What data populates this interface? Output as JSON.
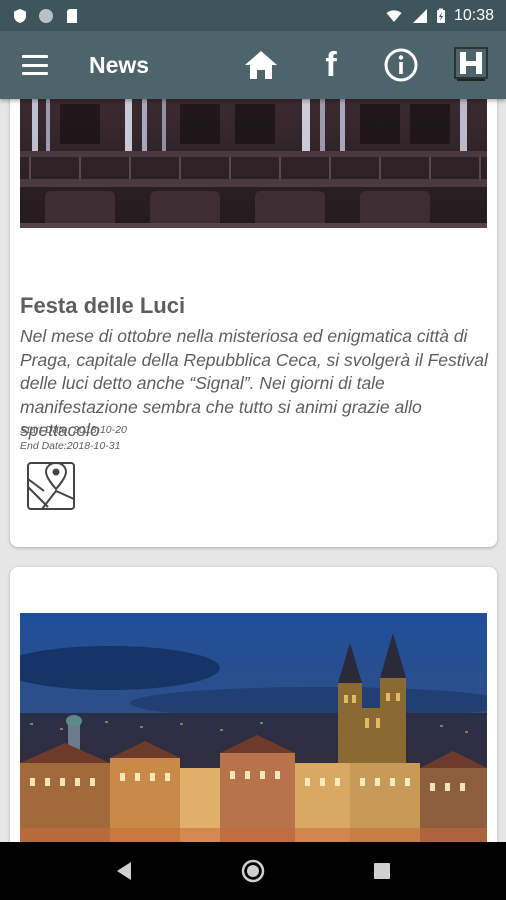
{
  "status_bar": {
    "time": "10:38",
    "icons": [
      "shield-icon",
      "circle-icon",
      "sd-card-icon",
      "wifi-icon",
      "signal-icon",
      "battery-icon"
    ]
  },
  "app_bar": {
    "title": "News",
    "actions": [
      "home-icon",
      "facebook-icon",
      "info-icon",
      "logo-icon"
    ],
    "facebook_glyph": "f"
  },
  "cards": [
    {
      "title": "Festa delle Luci",
      "description": "Nel mese di ottobre nella misteriosa ed enigmatica città di Praga, capitale della Repubblica Ceca, si svolgerà il Festival delle luci detto anche “Signal”. Nei giorni di tale manifestazione sembra che tutto si animi grazie allo spettacolo",
      "start_date": "Start Date: 2018-10-20",
      "end_date": "End Date:2018-10-31",
      "map_icon": "map-pin-icon"
    }
  ],
  "nav_bar": {
    "buttons": [
      "back-icon",
      "home-circle-icon",
      "recents-icon"
    ]
  },
  "colors": {
    "status_bar": "#3f555c",
    "app_bar": "#4e646b",
    "text": "#5e5e5e",
    "background": "#e6e6e6"
  }
}
